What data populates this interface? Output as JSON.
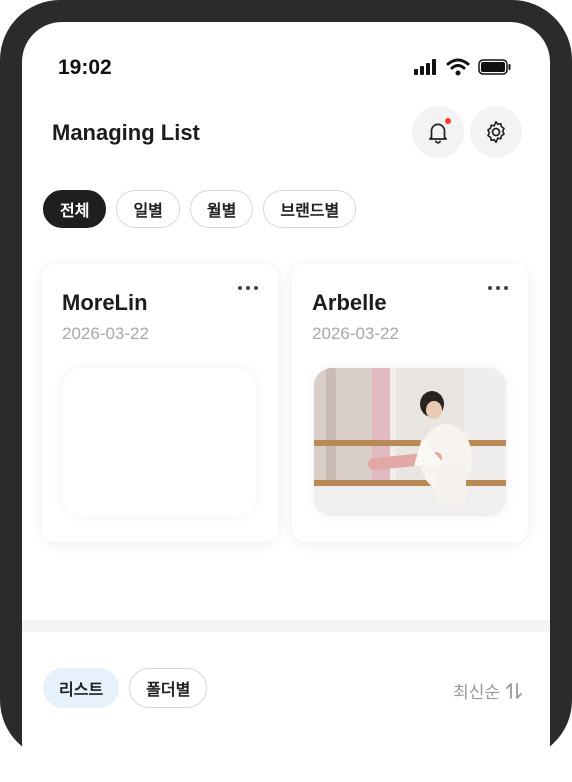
{
  "status_bar": {
    "time": "19:02"
  },
  "header": {
    "title": "Managing List"
  },
  "filters": [
    {
      "label": "전체",
      "active": true
    },
    {
      "label": "일별",
      "active": false
    },
    {
      "label": "월별",
      "active": false
    },
    {
      "label": "브랜드별",
      "active": false
    }
  ],
  "cards": [
    {
      "name": "MoreLin",
      "date": "2026-03-22",
      "has_image": false
    },
    {
      "name": "Arbelle",
      "date": "2026-03-22",
      "has_image": true
    }
  ],
  "bottom_tabs": [
    {
      "label": "리스트",
      "active": true
    },
    {
      "label": "폴더별",
      "active": false
    }
  ],
  "sort": {
    "label": "최신순"
  },
  "colors": {
    "accent_chip": "#1f1f1f",
    "notification_dot": "#ff3b30",
    "active_tab_bg": "#e6f1fc"
  }
}
